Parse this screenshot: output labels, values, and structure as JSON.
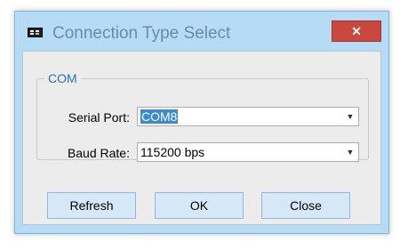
{
  "window": {
    "title": "Connection Type Select",
    "close_label": "✕"
  },
  "group": {
    "legend": "COM",
    "serial_port_label": "Serial Port:",
    "serial_port_value": "COM8",
    "baud_rate_label": "Baud Rate:",
    "baud_rate_value": "115200 bps"
  },
  "buttons": {
    "refresh": "Refresh",
    "ok": "OK",
    "close": "Close"
  },
  "icons": {
    "app": "app-icon",
    "dropdown": "chevron-down-icon"
  },
  "colors": {
    "frame": "#b6dbf5",
    "close_button": "#c9473c",
    "legend": "#2e6fb5",
    "selection": "#3a8ad4",
    "button_bg": "#d6e8f7"
  }
}
